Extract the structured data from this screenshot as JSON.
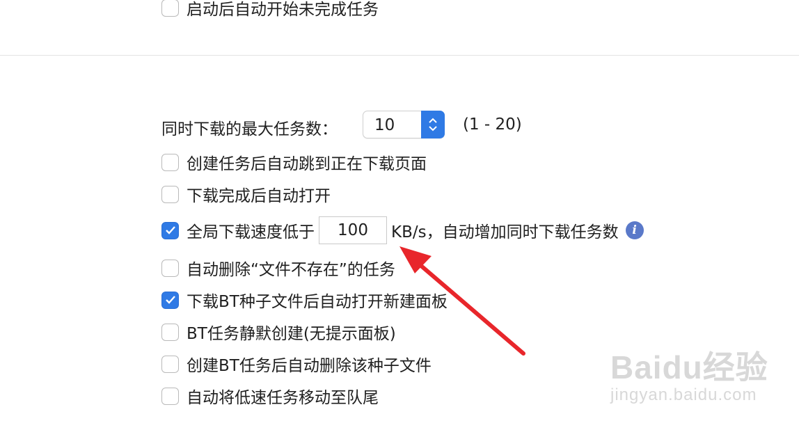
{
  "top": {
    "option_autostart": {
      "label": "启动后自动开始未完成任务",
      "checked": false
    }
  },
  "max_tasks": {
    "label": "同时下载的最大任务数：",
    "value": "10",
    "range": "(1 - 20)"
  },
  "options": [
    {
      "label": "创建任务后自动跳到正在下载页面",
      "checked": false
    },
    {
      "label": "下载完成后自动打开",
      "checked": false
    },
    {
      "label_before": "全局下载速度低于",
      "input_value": "100",
      "label_after": "KB/s，自动增加同时下载任务数",
      "checked": true
    },
    {
      "label": "自动删除“文件不存在”的任务",
      "checked": false
    },
    {
      "label": "下载BT种子文件后自动打开新建面板",
      "checked": true
    },
    {
      "label": "BT任务静默创建(无提示面板)",
      "checked": false
    },
    {
      "label": "创建BT任务后自动删除该种子文件",
      "checked": false
    },
    {
      "label": "自动将低速任务移动至队尾",
      "checked": false
    }
  ],
  "info_icon": "i",
  "watermark": {
    "logo": "Baidu经验",
    "url": "jingyan.baidu.com"
  },
  "colors": {
    "accent": "#2f7ae5",
    "arrow": "#e8262b",
    "info": "#5a79c9"
  }
}
